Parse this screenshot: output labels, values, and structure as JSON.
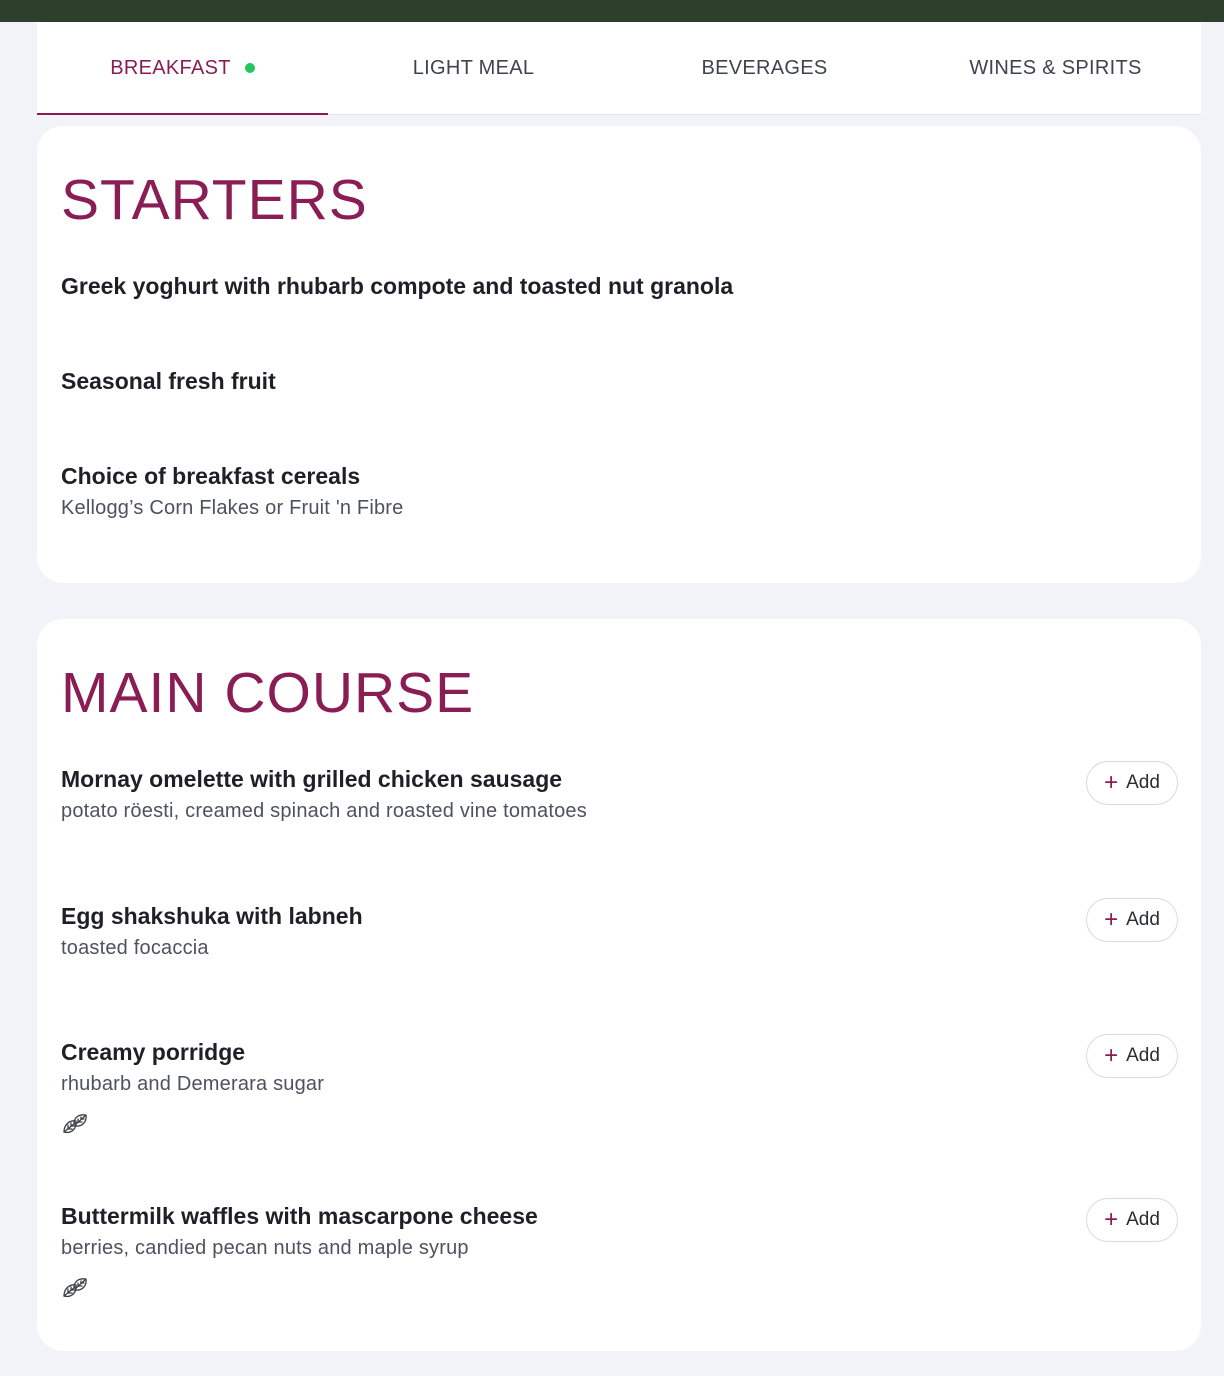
{
  "tabs": [
    {
      "label": "BREAKFAST",
      "active": true,
      "indicator_color": "#22c55e"
    },
    {
      "label": "LIGHT MEAL",
      "active": false
    },
    {
      "label": "BEVERAGES",
      "active": false
    },
    {
      "label": "WINES & SPIRITS",
      "active": false
    }
  ],
  "colors": {
    "accent": "#8a1d53",
    "top_bar": "#2e3f2b",
    "background": "#f2f2f9"
  },
  "starters": {
    "title": "STARTERS",
    "items": [
      {
        "name": "Greek yoghurt with rhubarb compote and toasted nut granola",
        "description": ""
      },
      {
        "name": "Seasonal fresh fruit",
        "description": ""
      },
      {
        "name": "Choice of breakfast cereals",
        "description": "Kellogg’s Corn Flakes or Fruit 'n Fibre"
      }
    ]
  },
  "main_course": {
    "title": "MAIN COURSE",
    "add_label": "Add",
    "items": [
      {
        "name": "Mornay omelette with grilled chicken sausage",
        "description": "potato röesti, creamed spinach and roasted vine tomatoes",
        "icon": "none"
      },
      {
        "name": "Egg shakshuka with labneh",
        "description": "toasted focaccia",
        "icon": "none"
      },
      {
        "name": "Creamy porridge",
        "description": "rhubarb and Demerara sugar",
        "icon": "vegetarian-leaf-icon"
      },
      {
        "name": "Buttermilk waffles with mascarpone cheese",
        "description": "berries, candied pecan nuts and maple syrup",
        "icon": "vegetarian-leaf-icon"
      }
    ]
  }
}
